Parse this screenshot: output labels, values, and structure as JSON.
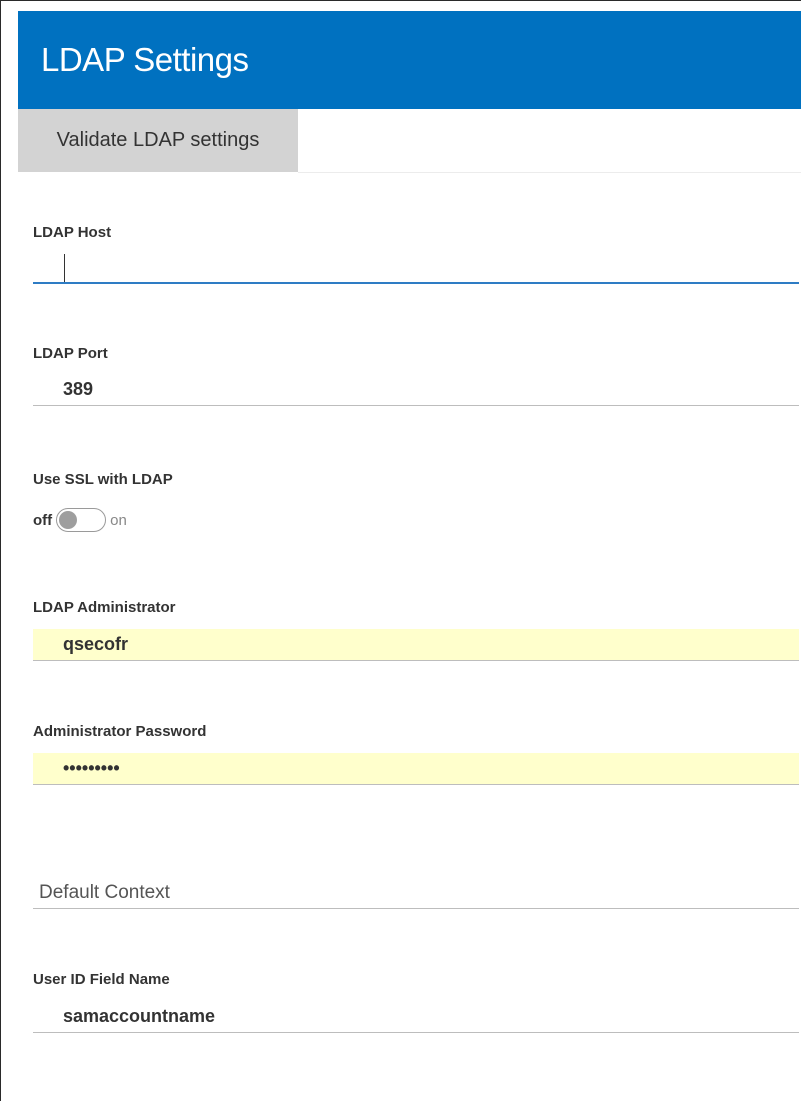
{
  "header": {
    "title": "LDAP Settings"
  },
  "toolbar": {
    "validate_label": "Validate LDAP settings"
  },
  "fields": {
    "ldap_host": {
      "label": "LDAP Host",
      "value": ""
    },
    "ldap_port": {
      "label": "LDAP Port",
      "value": "389"
    },
    "use_ssl": {
      "label": "Use SSL with LDAP",
      "off_label": "off",
      "on_label": "on",
      "state": "off"
    },
    "ldap_admin": {
      "label": "LDAP Administrator",
      "value": "qsecofr"
    },
    "admin_password": {
      "label": "Administrator Password",
      "value": "*********"
    },
    "default_context": {
      "placeholder": "Default Context",
      "value": ""
    },
    "user_id_field": {
      "label": "User ID Field Name",
      "value": "samaccountname"
    }
  },
  "colors": {
    "header_bg": "#0071c0",
    "button_bg": "#d3d3d3",
    "autofill_bg": "#ffffcc",
    "focus_underline": "#2e7cc4"
  }
}
